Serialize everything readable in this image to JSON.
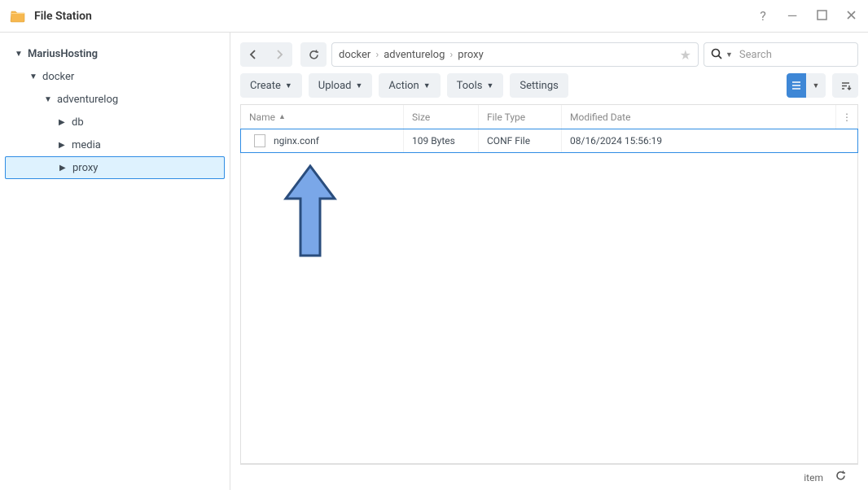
{
  "app_title": "File Station",
  "tree": {
    "root": "MariusHosting",
    "l1": "docker",
    "l2": "adventurelog",
    "l3_1": "db",
    "l3_2": "media",
    "l3_3": "proxy"
  },
  "breadcrumb": {
    "p1": "docker",
    "p2": "adventurelog",
    "p3": "proxy"
  },
  "search": {
    "placeholder": "Search"
  },
  "toolbar": {
    "create": "Create",
    "upload": "Upload",
    "action": "Action",
    "tools": "Tools",
    "settings": "Settings"
  },
  "columns": {
    "name": "Name",
    "size": "Size",
    "type": "File Type",
    "date": "Modified Date"
  },
  "rows": [
    {
      "name": "nginx.conf",
      "size": "109 Bytes",
      "type": "CONF File",
      "date": "08/16/2024 15:56:19"
    }
  ],
  "status": {
    "item": "item"
  }
}
